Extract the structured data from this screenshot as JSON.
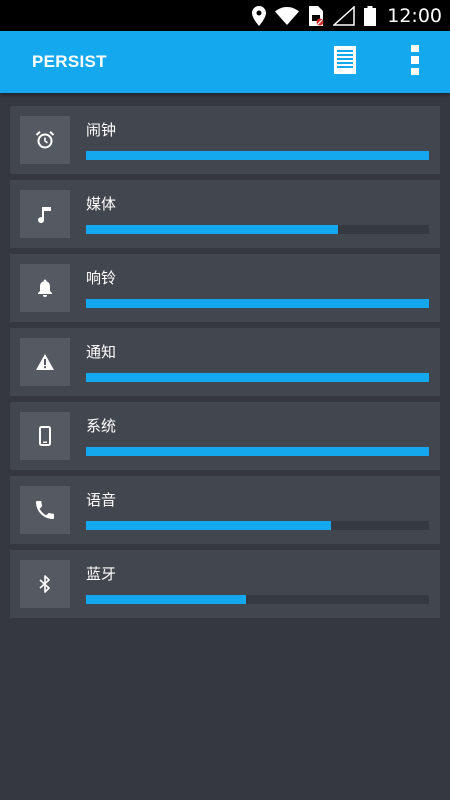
{
  "status_bar": {
    "time": "12:00",
    "icons": [
      "location-icon",
      "wifi-icon",
      "sim-card-icon",
      "signal-icon",
      "battery-icon"
    ]
  },
  "app_bar": {
    "title": "PERSIST",
    "color": "#14a9ef",
    "actions": [
      "log-icon",
      "overflow-menu-icon"
    ]
  },
  "volumes": [
    {
      "label": "闹钟",
      "icon": "alarm-clock-icon",
      "level": 1.0
    },
    {
      "label": "媒体",
      "icon": "music-note-icon",
      "level": 0.735
    },
    {
      "label": "响铃",
      "icon": "bell-icon",
      "level": 1.0
    },
    {
      "label": "通知",
      "icon": "warning-icon",
      "level": 1.0
    },
    {
      "label": "系统",
      "icon": "phone-icon",
      "level": 1.0
    },
    {
      "label": "语音",
      "icon": "call-icon",
      "level": 0.715
    },
    {
      "label": "蓝牙",
      "icon": "bluetooth-icon",
      "level": 0.467
    }
  ],
  "colors": {
    "background": "#353840",
    "card": "#42464e",
    "icon_box": "#555a62",
    "track": "#353941",
    "fill": "#14a9ef"
  }
}
